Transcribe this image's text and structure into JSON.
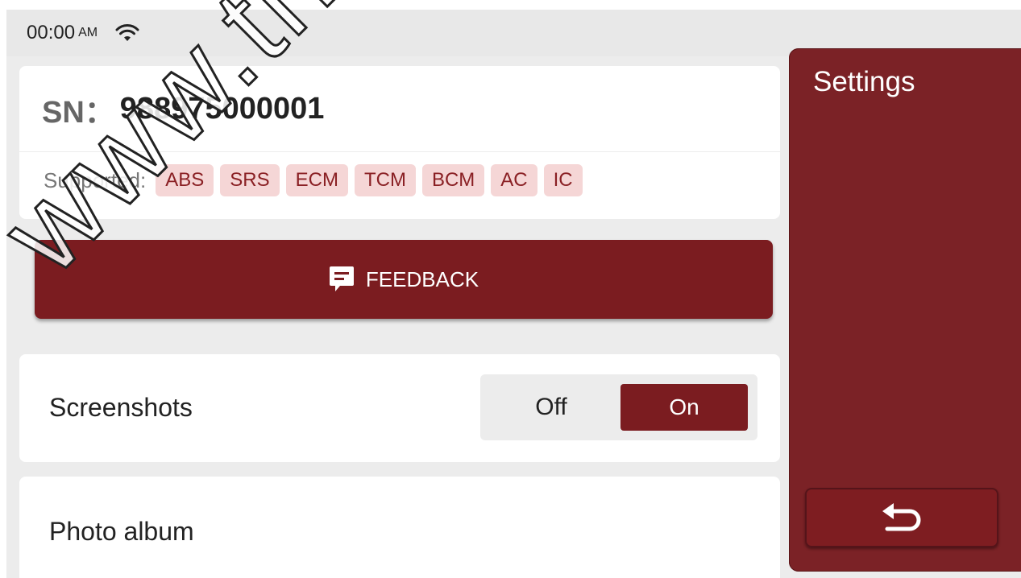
{
  "status_bar": {
    "time": "00:00",
    "ampm": "AM",
    "wifi_icon": "wifi-icon"
  },
  "device": {
    "sn_label": "SN：",
    "sn_value": "988975000001",
    "supported_label": "Supported:",
    "supported_systems": [
      "ABS",
      "SRS",
      "ECM",
      "TCM",
      "BCM",
      "AC",
      "IC"
    ]
  },
  "feedback": {
    "label": "FEEDBACK",
    "icon": "feedback-icon"
  },
  "screenshots": {
    "label": "Screenshots",
    "off_label": "Off",
    "on_label": "On",
    "selected": "On"
  },
  "photo_album": {
    "label": "Photo album"
  },
  "side_panel": {
    "title": "Settings",
    "back_icon": "back-arrow-icon"
  },
  "watermark": {
    "text": "www.thin"
  },
  "colors": {
    "accent": "#7b1c20",
    "tag_bg": "#f5d6d6",
    "tag_text": "#8a2024",
    "background": "#ececec"
  }
}
